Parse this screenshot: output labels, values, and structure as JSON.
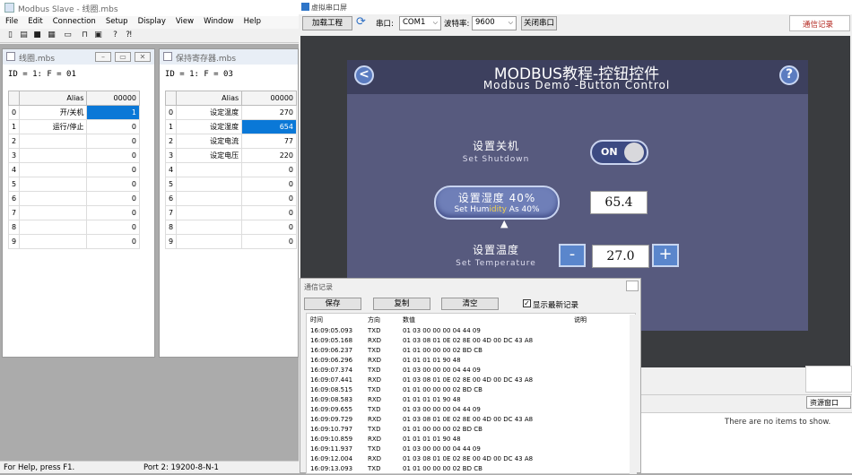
{
  "modbus_slave": {
    "title": "Modbus Slave - 线圈.mbs",
    "menu": [
      "File",
      "Edit",
      "Connection",
      "Setup",
      "Display",
      "View",
      "Window",
      "Help"
    ],
    "coil_window": {
      "title": "线圈.mbs",
      "id_line": "ID = 1: F = 01",
      "header_alias": "Alias",
      "header_col": "00000",
      "rows": [
        {
          "idx": "0",
          "alias": "开/关机",
          "value": "1"
        },
        {
          "idx": "1",
          "alias": "运行/停止",
          "value": "0"
        },
        {
          "idx": "2",
          "alias": "",
          "value": "0"
        },
        {
          "idx": "3",
          "alias": "",
          "value": "0"
        },
        {
          "idx": "4",
          "alias": "",
          "value": "0"
        },
        {
          "idx": "5",
          "alias": "",
          "value": "0"
        },
        {
          "idx": "6",
          "alias": "",
          "value": "0"
        },
        {
          "idx": "7",
          "alias": "",
          "value": "0"
        },
        {
          "idx": "8",
          "alias": "",
          "value": "0"
        },
        {
          "idx": "9",
          "alias": "",
          "value": "0"
        }
      ]
    },
    "register_window": {
      "title": "保持寄存器.mbs",
      "id_line": "ID = 1: F = 03",
      "header_alias": "Alias",
      "header_col": "00000",
      "rows": [
        {
          "idx": "0",
          "alias": "设定温度",
          "value": "270"
        },
        {
          "idx": "1",
          "alias": "设定湿度",
          "value": "654"
        },
        {
          "idx": "2",
          "alias": "设定电流",
          "value": "77"
        },
        {
          "idx": "3",
          "alias": "设定电压",
          "value": "220"
        },
        {
          "idx": "4",
          "alias": "",
          "value": "0"
        },
        {
          "idx": "5",
          "alias": "",
          "value": "0"
        },
        {
          "idx": "6",
          "alias": "",
          "value": "0"
        },
        {
          "idx": "7",
          "alias": "",
          "value": "0"
        },
        {
          "idx": "8",
          "alias": "",
          "value": "0"
        },
        {
          "idx": "9",
          "alias": "",
          "value": "0"
        }
      ]
    },
    "status_left": "For Help, press F1.",
    "status_right": "Port 2: 19200-8-N-1"
  },
  "serial_screen": {
    "title": "虚拟串口屏",
    "load_button": "加载工程",
    "port_label": "串口:",
    "port_value": "COM1",
    "baud_label": "波特率:",
    "baud_value": "9600",
    "close_port_button": "关闭串口",
    "log_link": "通信记录",
    "hmi": {
      "title_cn": "MODBUS教程-控钮控件",
      "title_en": "Modbus Demo -Button Control",
      "shutdown_cn": "设置关机",
      "shutdown_en": "Set Shutdown",
      "toggle_label": "ON",
      "humidity_cn": "设置湿度 40%",
      "humidity_en_a": "Set Hum",
      "humidity_en_b": "idity",
      "humidity_en_c": " As 40%",
      "humidity_value": "65.4",
      "temp_cn": "设置温度",
      "temp_en": "Set Temperature",
      "minus": "-",
      "temp_value": "27.0",
      "plus": "+",
      "back_glyph": "<",
      "help_glyph": "?"
    },
    "comm_log": {
      "title": "通信记录",
      "save_button": "保存",
      "copy_button": "复制",
      "clear_button": "清空",
      "show_latest_label": "显示最新记录",
      "col_time": "时间",
      "col_dir": "方向",
      "col_data": "数值",
      "col_desc": "说明",
      "rows": [
        {
          "t": "16:09:05.093",
          "d": "TXD",
          "v": "01 03 00 00 00 04 44 09"
        },
        {
          "t": "16:09:05.168",
          "d": "RXD",
          "v": "01 03 08 01 0E 02 8E 00 4D 00 DC 43 A8"
        },
        {
          "t": "16:09:06.237",
          "d": "TXD",
          "v": "01 01 00 00 00 02 BD CB"
        },
        {
          "t": "16:09:06.296",
          "d": "RXD",
          "v": "01 01 01 01 90 48"
        },
        {
          "t": "16:09:07.374",
          "d": "TXD",
          "v": "01 03 00 00 00 04 44 09"
        },
        {
          "t": "16:09:07.441",
          "d": "RXD",
          "v": "01 03 08 01 0E 02 8E 00 4D 00 DC 43 A8"
        },
        {
          "t": "16:09:08.515",
          "d": "TXD",
          "v": "01 01 00 00 00 02 BD CB"
        },
        {
          "t": "16:09:08.583",
          "d": "RXD",
          "v": "01 01 01 01 90 48"
        },
        {
          "t": "16:09:09.655",
          "d": "TXD",
          "v": "01 03 00 00 00 04 44 09"
        },
        {
          "t": "16:09:09.729",
          "d": "RXD",
          "v": "01 03 08 01 0E 02 8E 00 4D 00 DC 43 A8"
        },
        {
          "t": "16:09:10.797",
          "d": "TXD",
          "v": "01 01 00 00 00 02 BD CB"
        },
        {
          "t": "16:09:10.859",
          "d": "RXD",
          "v": "01 01 01 01 90 48"
        },
        {
          "t": "16:09:11.937",
          "d": "TXD",
          "v": "01 03 00 00 00 04 44 09"
        },
        {
          "t": "16:09:12.004",
          "d": "RXD",
          "v": "01 03 08 01 0E 02 8E 00 4D 00 DC 43 A8"
        },
        {
          "t": "16:09:13.093",
          "d": "TXD",
          "v": "01 01 00 00 00 02 BD CB"
        }
      ]
    },
    "resource_tab": "资源窗口",
    "empty_message": "There are no items to show."
  },
  "colors": {
    "hmi_bg": "#575a7e",
    "selection": "#0a78d7",
    "bezel": "#3a3c3f"
  }
}
